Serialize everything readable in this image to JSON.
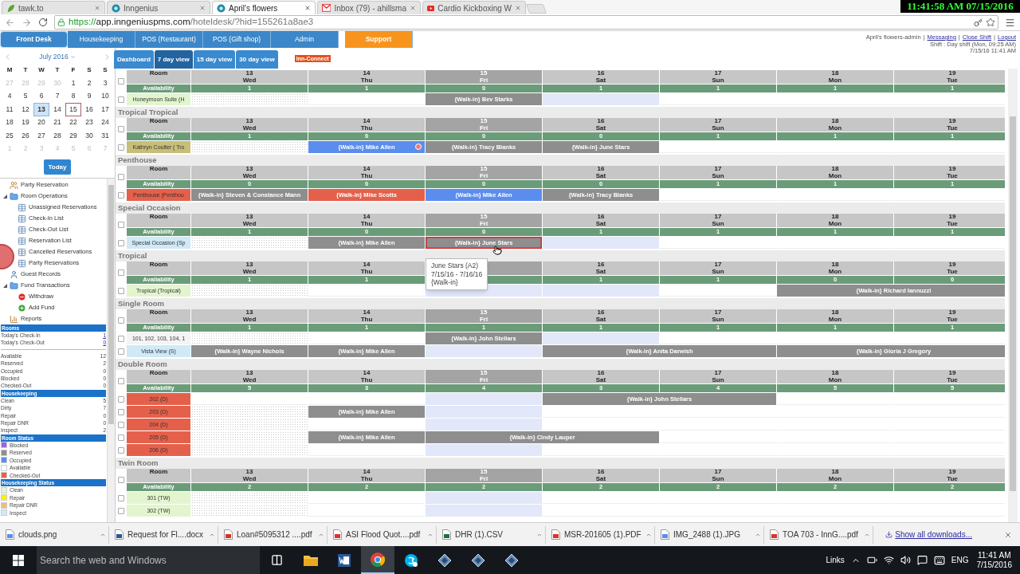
{
  "browser": {
    "tabs": [
      {
        "title": "tawk.to",
        "kind": "leaf",
        "selected": false
      },
      {
        "title": "Inngenius",
        "kind": "site",
        "selected": false
      },
      {
        "title": "April's flowers",
        "kind": "site",
        "selected": true
      },
      {
        "title": "Inbox (79) - ahillsma",
        "kind": "mail",
        "selected": false
      },
      {
        "title": "Cardio Kickboxing W",
        "kind": "video",
        "selected": false
      }
    ],
    "url": {
      "scheme": "https://",
      "host": "app.inngeniuspms.com",
      "path": "/hoteldesk/?hid=155261a8ae3"
    }
  },
  "clock": "11:41:58 AM 07/15/2016",
  "nav": [
    {
      "label": "Front Desk",
      "selected": true,
      "accent": false
    },
    {
      "label": "Housekeeping",
      "selected": false,
      "accent": false
    },
    {
      "label": "POS (Restaurant)",
      "selected": false,
      "accent": false
    },
    {
      "label": "POS (Gift shop)",
      "selected": false,
      "accent": false
    },
    {
      "label": "Admin",
      "selected": false,
      "accent": false
    },
    {
      "label": "Support",
      "selected": false,
      "accent": true
    }
  ],
  "account": {
    "user": "April's flowers-admin",
    "separators": [
      "|",
      "|",
      "|"
    ],
    "links": [
      "Messaging",
      "Close Shift",
      "Logout"
    ],
    "shift": "Shift : Day shift (Mon, 09:25 AM)",
    "datetime": "7/15/16 11:41 AM"
  },
  "views": [
    {
      "label": "Dashboard",
      "selected": false
    },
    {
      "label": "7 day view",
      "selected": true
    },
    {
      "label": "15 day view",
      "selected": false
    },
    {
      "label": "30 day view",
      "selected": false
    }
  ],
  "badge": "Inn-Connect",
  "calendar": {
    "month": "July 2016",
    "weekdays": [
      "M",
      "T",
      "W",
      "T",
      "F",
      "S",
      "S"
    ],
    "weeks": [
      [
        {
          "day": "27",
          "muted": true,
          "selected": false,
          "today": false
        },
        {
          "day": "28",
          "muted": true,
          "selected": false,
          "today": false
        },
        {
          "day": "29",
          "muted": true,
          "selected": false,
          "today": false
        },
        {
          "day": "30",
          "muted": true,
          "selected": false,
          "today": false
        },
        {
          "day": "1",
          "muted": false,
          "selected": false,
          "today": false
        },
        {
          "day": "2",
          "muted": false,
          "selected": false,
          "today": false
        },
        {
          "day": "3",
          "muted": false,
          "selected": false,
          "today": false
        }
      ],
      [
        {
          "day": "4",
          "muted": false,
          "selected": false,
          "today": false
        },
        {
          "day": "5",
          "muted": false,
          "selected": false,
          "today": false
        },
        {
          "day": "6",
          "muted": false,
          "selected": false,
          "today": false
        },
        {
          "day": "7",
          "muted": false,
          "selected": false,
          "today": false
        },
        {
          "day": "8",
          "muted": false,
          "selected": false,
          "today": false
        },
        {
          "day": "9",
          "muted": false,
          "selected": false,
          "today": false
        },
        {
          "day": "10",
          "muted": false,
          "selected": false,
          "today": false
        }
      ],
      [
        {
          "day": "11",
          "muted": false,
          "selected": false,
          "today": false
        },
        {
          "day": "12",
          "muted": false,
          "selected": false,
          "today": false
        },
        {
          "day": "13",
          "muted": false,
          "selected": true,
          "today": false
        },
        {
          "day": "14",
          "muted": false,
          "selected": false,
          "today": false
        },
        {
          "day": "15",
          "muted": false,
          "selected": false,
          "today": true
        },
        {
          "day": "16",
          "muted": false,
          "selected": false,
          "today": false
        },
        {
          "day": "17",
          "muted": false,
          "selected": false,
          "today": false
        }
      ],
      [
        {
          "day": "18",
          "muted": false,
          "selected": false,
          "today": false
        },
        {
          "day": "19",
          "muted": false,
          "selected": false,
          "today": false
        },
        {
          "day": "20",
          "muted": false,
          "selected": false,
          "today": false
        },
        {
          "day": "21",
          "muted": false,
          "selected": false,
          "today": false
        },
        {
          "day": "22",
          "muted": false,
          "selected": false,
          "today": false
        },
        {
          "day": "23",
          "muted": false,
          "selected": false,
          "today": false
        },
        {
          "day": "24",
          "muted": false,
          "selected": false,
          "today": false
        }
      ],
      [
        {
          "day": "25",
          "muted": false,
          "selected": false,
          "today": false
        },
        {
          "day": "26",
          "muted": false,
          "selected": false,
          "today": false
        },
        {
          "day": "27",
          "muted": false,
          "selected": false,
          "today": false
        },
        {
          "day": "28",
          "muted": false,
          "selected": false,
          "today": false
        },
        {
          "day": "29",
          "muted": false,
          "selected": false,
          "today": false
        },
        {
          "day": "30",
          "muted": false,
          "selected": false,
          "today": false
        },
        {
          "day": "31",
          "muted": false,
          "selected": false,
          "today": false
        }
      ],
      [
        {
          "day": "1",
          "muted": true,
          "selected": false,
          "today": false
        },
        {
          "day": "2",
          "muted": true,
          "selected": false,
          "today": false
        },
        {
          "day": "3",
          "muted": true,
          "selected": false,
          "today": false
        },
        {
          "day": "4",
          "muted": true,
          "selected": false,
          "today": false
        },
        {
          "day": "5",
          "muted": true,
          "selected": false,
          "today": false
        },
        {
          "day": "6",
          "muted": true,
          "selected": false,
          "today": false
        },
        {
          "day": "7",
          "muted": true,
          "selected": false,
          "today": false
        }
      ]
    ],
    "today_button": "Today"
  },
  "tree": [
    {
      "label": "Party Reservation",
      "kind": "party"
    },
    {
      "label": "Room Operations",
      "kind": "folder",
      "expanded": true,
      "children": [
        {
          "label": "Unassigned Reservations",
          "kind": "list"
        },
        {
          "label": "Check-In List",
          "kind": "list"
        },
        {
          "label": "Check-Out List",
          "kind": "list"
        },
        {
          "label": "Reservation List",
          "kind": "list"
        },
        {
          "label": "Cancelled Reservations",
          "kind": "list"
        },
        {
          "label": "Party Reservations",
          "kind": "list"
        }
      ]
    },
    {
      "label": "Guest Records",
      "kind": "person"
    },
    {
      "label": "Fund Transactions",
      "kind": "folder",
      "expanded": true,
      "children": [
        {
          "label": "Withdraw",
          "kind": "withdraw"
        },
        {
          "label": "Add Fund",
          "kind": "add"
        }
      ]
    },
    {
      "label": "Reports",
      "kind": "report"
    }
  ],
  "summary": [
    {
      "title": "Rooms",
      "rows": [
        {
          "label": "Today's Check-In",
          "value": "1",
          "link": true
        },
        {
          "label": "Today's Check-Out",
          "value": "0",
          "link": true
        }
      ]
    },
    {
      "rows": [
        {
          "label": "Available",
          "value": "12"
        },
        {
          "label": "Reserved",
          "value": "2"
        },
        {
          "label": "Occupied",
          "value": "0"
        },
        {
          "label": "Blocked",
          "value": "0"
        },
        {
          "label": "Checked-Out",
          "value": "0"
        }
      ]
    },
    {
      "title": "Housekeeping",
      "rows": [
        {
          "label": "Clean",
          "value": "5"
        },
        {
          "label": "Dirty",
          "value": "7"
        },
        {
          "label": "Repair",
          "value": "0"
        },
        {
          "label": "Repair DNR",
          "value": "0"
        },
        {
          "label": "Inspect",
          "value": "2"
        }
      ]
    },
    {
      "title": "Room Status",
      "legend": [
        {
          "label": "Blocked",
          "color": "#9966e0"
        },
        {
          "label": "Reserved",
          "color": "#8e8e8e"
        },
        {
          "label": "Occupied",
          "color": "#5b8def"
        },
        {
          "label": "Available",
          "color": "#ffffff"
        },
        {
          "label": "Checked-Out",
          "color": "#e5604b"
        }
      ]
    },
    {
      "title": "Housekeeping Status",
      "legend": [
        {
          "label": "Clean",
          "color": "#e2f5cf"
        },
        {
          "label": "Repair",
          "color": "#fff200"
        },
        {
          "label": "Repair DNR",
          "color": "#f0c070"
        },
        {
          "label": "Inspect",
          "color": "#cfe9f7"
        }
      ]
    }
  ],
  "groups": [
    {
      "room_header": "Room",
      "availability_label": "Availability",
      "checked": false,
      "days": [
        {
          "date": "13",
          "weekday": "Wed",
          "today": false,
          "availability": "1"
        },
        {
          "date": "14",
          "weekday": "Thu",
          "today": false,
          "availability": "1"
        },
        {
          "date": "15",
          "weekday": "Fri",
          "today": true,
          "availability": "0"
        },
        {
          "date": "16",
          "weekday": "Sat",
          "today": false,
          "availability": "1"
        },
        {
          "date": "17",
          "weekday": "Sun",
          "today": false,
          "availability": "1"
        },
        {
          "date": "18",
          "weekday": "Mon",
          "today": false,
          "availability": "1"
        },
        {
          "date": "19",
          "weekday": "Tue",
          "today": false,
          "availability": "1"
        }
      ],
      "rows": [
        {
          "label": "Honeymoon Suite (H",
          "color": "#e2f5cf",
          "checked": false,
          "cells": [
            {
              "kind": "past"
            },
            {
              "kind": "vacant"
            },
            {
              "kind": "reserved",
              "text": "{Walk-in} Bev Starks",
              "selected": false,
              "alert": false
            },
            {
              "kind": "current"
            },
            {
              "kind": "vacant"
            },
            {
              "kind": "vacant"
            },
            {
              "kind": "vacant"
            }
          ]
        }
      ]
    },
    {
      "title": "Tropical Tropical",
      "room_header": "Room",
      "availability_label": "Availability",
      "checked": false,
      "days": [
        {
          "date": "13",
          "weekday": "Wed",
          "today": false,
          "availability": "1"
        },
        {
          "date": "14",
          "weekday": "Thu",
          "today": false,
          "availability": "0"
        },
        {
          "date": "15",
          "weekday": "Fri",
          "today": true,
          "availability": "0"
        },
        {
          "date": "16",
          "weekday": "Sat",
          "today": false,
          "availability": "0"
        },
        {
          "date": "17",
          "weekday": "Sun",
          "today": false,
          "availability": "1"
        },
        {
          "date": "18",
          "weekday": "Mon",
          "today": false,
          "availability": "1"
        },
        {
          "date": "19",
          "weekday": "Tue",
          "today": false,
          "availability": "1"
        }
      ],
      "rows": [
        {
          "label": "Kathryn Coulter ( Tro",
          "color": "#c8be7a",
          "checked": false,
          "cells": [
            {
              "kind": "past"
            },
            {
              "kind": "occupied",
              "text": "{Walk-in} Mike Allen",
              "selected": false,
              "alert": true
            },
            {
              "kind": "reserved",
              "text": "{Walk-in} Tracy Blanks",
              "selected": false,
              "alert": false
            },
            {
              "kind": "reserved",
              "text": "{Walk-in} June Stars",
              "selected": false,
              "alert": false
            },
            {
              "kind": "vacant"
            },
            {
              "kind": "vacant"
            },
            {
              "kind": "vacant"
            }
          ]
        }
      ]
    },
    {
      "title": "Penthouse",
      "room_header": "Room",
      "availability_label": "Availability",
      "checked": false,
      "days": [
        {
          "date": "13",
          "weekday": "Wed",
          "today": false,
          "availability": "0"
        },
        {
          "date": "14",
          "weekday": "Thu",
          "today": false,
          "availability": "0"
        },
        {
          "date": "15",
          "weekday": "Fri",
          "today": true,
          "availability": "0"
        },
        {
          "date": "16",
          "weekday": "Sat",
          "today": false,
          "availability": "0"
        },
        {
          "date": "17",
          "weekday": "Sun",
          "today": false,
          "availability": "1"
        },
        {
          "date": "18",
          "weekday": "Mon",
          "today": false,
          "availability": "1"
        },
        {
          "date": "19",
          "weekday": "Tue",
          "today": false,
          "availability": "1"
        }
      ],
      "rows": [
        {
          "label": "Penthouse (Penthou",
          "color": "#e5604b",
          "checked": false,
          "cells": [
            {
              "kind": "reserved",
              "text": "{Walk-in} Steven & Constance Mann",
              "selected": false,
              "alert": false
            },
            {
              "kind": "checked_out",
              "text": "{Walk-in} Mike Scotts",
              "selected": false,
              "alert": false
            },
            {
              "kind": "occupied",
              "text": "{Walk-in} Mike Allen",
              "selected": false,
              "alert": false
            },
            {
              "kind": "reserved",
              "text": "{Walk-in} Tracy Blanks",
              "selected": false,
              "alert": false
            },
            {
              "kind": "vacant"
            },
            {
              "kind": "vacant"
            },
            {
              "kind": "vacant"
            }
          ]
        }
      ]
    },
    {
      "title": "Special Occasion",
      "room_header": "Room",
      "availability_label": "Availability",
      "checked": false,
      "days": [
        {
          "date": "13",
          "weekday": "Wed",
          "today": false,
          "availability": "1"
        },
        {
          "date": "14",
          "weekday": "Thu",
          "today": false,
          "availability": "0"
        },
        {
          "date": "15",
          "weekday": "Fri",
          "today": true,
          "availability": "0"
        },
        {
          "date": "16",
          "weekday": "Sat",
          "today": false,
          "availability": "1"
        },
        {
          "date": "17",
          "weekday": "Sun",
          "today": false,
          "availability": "1"
        },
        {
          "date": "18",
          "weekday": "Mon",
          "today": false,
          "availability": "1"
        },
        {
          "date": "19",
          "weekday": "Tue",
          "today": false,
          "availability": "1"
        }
      ],
      "rows": [
        {
          "label": "Special Occasion (Sp",
          "color": "#cfe9f7",
          "checked": false,
          "cells": [
            {
              "kind": "past"
            },
            {
              "kind": "reserved",
              "text": "{Walk-in} Mike Allen",
              "selected": false,
              "alert": false
            },
            {
              "kind": "reserved",
              "text": "{Walk-in} June Stars",
              "selected": true,
              "alert": false
            },
            {
              "kind": "current"
            },
            {
              "kind": "vacant"
            },
            {
              "kind": "vacant"
            },
            {
              "kind": "vacant"
            }
          ]
        }
      ]
    },
    {
      "title": "Tropical",
      "room_header": "Room",
      "availability_label": "Availability",
      "checked": false,
      "days": [
        {
          "date": "13",
          "weekday": "Wed",
          "today": false,
          "availability": "1"
        },
        {
          "date": "14",
          "weekday": "Thu",
          "today": false,
          "availability": "1"
        },
        {
          "today": true
        },
        {
          "date": "16",
          "weekday": "Sat",
          "today": false,
          "availability": "1"
        },
        {
          "date": "17",
          "weekday": "Sun",
          "today": false,
          "availability": "1"
        },
        {
          "date": "18",
          "weekday": "Mon",
          "today": false,
          "availability": "0"
        },
        {
          "date": "19",
          "weekday": "Tue",
          "today": false,
          "availability": "0"
        }
      ],
      "rows": [
        {
          "label": "Tropical (Tropical)",
          "color": "#e2f5cf",
          "checked": false,
          "cells": [
            {
              "kind": "past"
            },
            {
              "kind": "vacant"
            },
            {
              "kind": "current"
            },
            {
              "kind": "current"
            },
            {
              "kind": "vacant"
            },
            {
              "kind": "reserved",
              "text": "{Walk-in} Richard Iannuzzi",
              "selected": false,
              "alert": false
            },
            {
              "kind": "continued"
            }
          ]
        }
      ]
    },
    {
      "title": "Single Room",
      "room_header": "Room",
      "availability_label": "Availability",
      "checked": false,
      "days": [
        {
          "date": "13",
          "weekday": "Wed",
          "today": false,
          "availability": "1"
        },
        {
          "date": "14",
          "weekday": "Thu",
          "today": false,
          "availability": "1"
        },
        {
          "date": "15",
          "weekday": "Fri",
          "today": true,
          "availability": "1"
        },
        {
          "date": "16",
          "weekday": "Sat",
          "today": false,
          "availability": "1"
        },
        {
          "date": "17",
          "weekday": "Sun",
          "today": false,
          "availability": "1"
        },
        {
          "date": "18",
          "weekday": "Mon",
          "today": false,
          "availability": "1"
        },
        {
          "date": "19",
          "weekday": "Tue",
          "today": false,
          "availability": "1"
        }
      ],
      "rows": [
        {
          "label": "101, 102, 103, 104, 1",
          "color": "#f4f4f4",
          "checked": false,
          "cells": [
            {
              "kind": "past"
            },
            {
              "kind": "vacant"
            },
            {
              "kind": "reserved",
              "text": "{Walk-in} John Stellars",
              "selected": false,
              "alert": false
            },
            {
              "kind": "current"
            },
            {
              "kind": "vacant"
            },
            {
              "kind": "vacant"
            },
            {
              "kind": "vacant"
            }
          ]
        },
        {
          "label": "Vista View (S)",
          "color": "#cfe9f7",
          "checked": false,
          "cells": [
            {
              "kind": "reserved",
              "text": "{Walk-in} Wayne Nichols",
              "selected": false,
              "alert": false
            },
            {
              "kind": "reserved",
              "text": "{Walk-in} Mike Allen",
              "selected": false,
              "alert": false
            },
            {
              "kind": "current"
            },
            {
              "kind": "reserved",
              "text": "{Walk-in} Anita Darwish",
              "selected": false,
              "alert": false
            },
            {
              "kind": "continued"
            },
            {
              "kind": "reserved",
              "text": "{Walk-in} Gloria J Gregory",
              "selected": false,
              "alert": false
            },
            {
              "kind": "continued"
            }
          ]
        }
      ]
    },
    {
      "title": "Double Room",
      "room_header": "Room",
      "availability_label": "Availability",
      "checked": false,
      "days": [
        {
          "date": "13",
          "weekday": "Wed",
          "today": false,
          "availability": "5"
        },
        {
          "date": "14",
          "weekday": "Thu",
          "today": false,
          "availability": "3"
        },
        {
          "date": "15",
          "weekday": "Fri",
          "today": true,
          "availability": "4"
        },
        {
          "date": "16",
          "weekday": "Sat",
          "today": false,
          "availability": "3"
        },
        {
          "date": "17",
          "weekday": "Sun",
          "today": false,
          "availability": "4"
        },
        {
          "date": "18",
          "weekday": "Mon",
          "today": false,
          "availability": "5"
        },
        {
          "date": "19",
          "weekday": "Tue",
          "today": false,
          "availability": "5"
        }
      ],
      "rows": [
        {
          "label": "202 (D)",
          "color": "#e5604b",
          "checked": false,
          "cells": [
            {
              "kind": "vacant"
            },
            {
              "kind": "vacant"
            },
            {
              "kind": "current"
            },
            {
              "kind": "reserved",
              "text": "{Walk-in} John Stellars",
              "selected": false,
              "alert": false
            },
            {
              "kind": "continued"
            },
            {
              "kind": "vacant"
            },
            {
              "kind": "vacant"
            }
          ]
        },
        {
          "label": "203 (D)",
          "color": "#e5604b",
          "checked": false,
          "cells": [
            {
              "kind": "past"
            },
            {
              "kind": "reserved",
              "text": "{Walk-in} Mike Allen",
              "selected": false,
              "alert": false
            },
            {
              "kind": "current"
            },
            {
              "kind": "vacant"
            },
            {
              "kind": "vacant"
            },
            {
              "kind": "vacant"
            },
            {
              "kind": "vacant"
            }
          ]
        },
        {
          "label": "204 (D)",
          "color": "#e5604b",
          "checked": false,
          "cells": [
            {
              "kind": "past"
            },
            {
              "kind": "vacant"
            },
            {
              "kind": "current"
            },
            {
              "kind": "vacant"
            },
            {
              "kind": "vacant"
            },
            {
              "kind": "vacant"
            },
            {
              "kind": "vacant"
            }
          ]
        },
        {
          "label": "205 (D)",
          "color": "#e5604b",
          "checked": false,
          "cells": [
            {
              "kind": "past"
            },
            {
              "kind": "reserved",
              "text": "{Walk-in} Mike Allen",
              "selected": false,
              "alert": false
            },
            {
              "kind": "reserved",
              "text": "{Walk-in} Cindy Lauper",
              "selected": false,
              "alert": false
            },
            {
              "kind": "continued"
            },
            {
              "kind": "vacant"
            },
            {
              "kind": "vacant"
            },
            {
              "kind": "vacant"
            }
          ]
        },
        {
          "label": "206 (D)",
          "color": "#e5604b",
          "checked": false,
          "cells": [
            {
              "kind": "past"
            },
            {
              "kind": "vacant"
            },
            {
              "kind": "current"
            },
            {
              "kind": "vacant"
            },
            {
              "kind": "vacant"
            },
            {
              "kind": "vacant"
            },
            {
              "kind": "vacant"
            }
          ]
        }
      ]
    },
    {
      "title": "Twin Room",
      "room_header": "Room",
      "availability_label": "Availability",
      "checked": false,
      "days": [
        {
          "date": "13",
          "weekday": "Wed",
          "today": false,
          "availability": "2"
        },
        {
          "date": "14",
          "weekday": "Thu",
          "today": false,
          "availability": "2"
        },
        {
          "date": "15",
          "weekday": "Fri",
          "today": true,
          "availability": "2"
        },
        {
          "date": "16",
          "weekday": "Sat",
          "today": false,
          "availability": "2"
        },
        {
          "date": "17",
          "weekday": "Sun",
          "today": false,
          "availability": "2"
        },
        {
          "date": "18",
          "weekday": "Mon",
          "today": false,
          "availability": "2"
        },
        {
          "date": "19",
          "weekday": "Tue",
          "today": false,
          "availability": "2"
        }
      ],
      "rows": [
        {
          "label": "301 (TW)",
          "color": "#e2f5cf",
          "checked": false,
          "cells": [
            {
              "kind": "past"
            },
            {
              "kind": "vacant"
            },
            {
              "kind": "current"
            },
            {
              "kind": "vacant"
            },
            {
              "kind": "vacant"
            },
            {
              "kind": "vacant"
            },
            {
              "kind": "vacant"
            }
          ]
        },
        {
          "label": "302 (TW)",
          "color": "#e2f5cf",
          "checked": false,
          "cells": [
            {
              "kind": "past"
            },
            {
              "kind": "vacant"
            },
            {
              "kind": "current"
            },
            {
              "kind": "vacant"
            },
            {
              "kind": "vacant"
            },
            {
              "kind": "vacant"
            },
            {
              "kind": "vacant"
            }
          ]
        }
      ]
    }
  ],
  "tooltip": {
    "lines": [
      "June Stars (A2)",
      "7/15/16 - 7/16/16",
      "{Walk-in}"
    ]
  },
  "downloads": {
    "items": [
      {
        "name": "clouds.png",
        "kind": "image"
      },
      {
        "name": "Request for Fl....docx",
        "kind": "doc"
      },
      {
        "name": "Loan#5095312 ....pdf",
        "kind": "pdf"
      },
      {
        "name": "ASI Flood Quot....pdf",
        "kind": "pdf"
      },
      {
        "name": "DHR (1).CSV",
        "kind": "sheet"
      },
      {
        "name": "MSR-201605 (1).PDF",
        "kind": "pdf"
      },
      {
        "name": "IMG_2488 (1).JPG",
        "kind": "image"
      },
      {
        "name": "TOA 703 - InnG....pdf",
        "kind": "pdf"
      }
    ],
    "show_all": "Show all downloads..."
  },
  "taskbar": {
    "search": "Search the web and Windows",
    "apps": [
      {
        "kind": "files",
        "selected": false
      },
      {
        "kind": "word",
        "selected": false
      },
      {
        "kind": "browser",
        "selected": true
      },
      {
        "kind": "chat",
        "selected": false
      },
      {
        "kind": "tool",
        "selected": false
      },
      {
        "kind": "tool",
        "selected": false
      },
      {
        "kind": "tool",
        "selected": false
      }
    ],
    "links": "Links",
    "language": "ENG",
    "time": "11:41 AM",
    "date": "7/15/2016"
  }
}
